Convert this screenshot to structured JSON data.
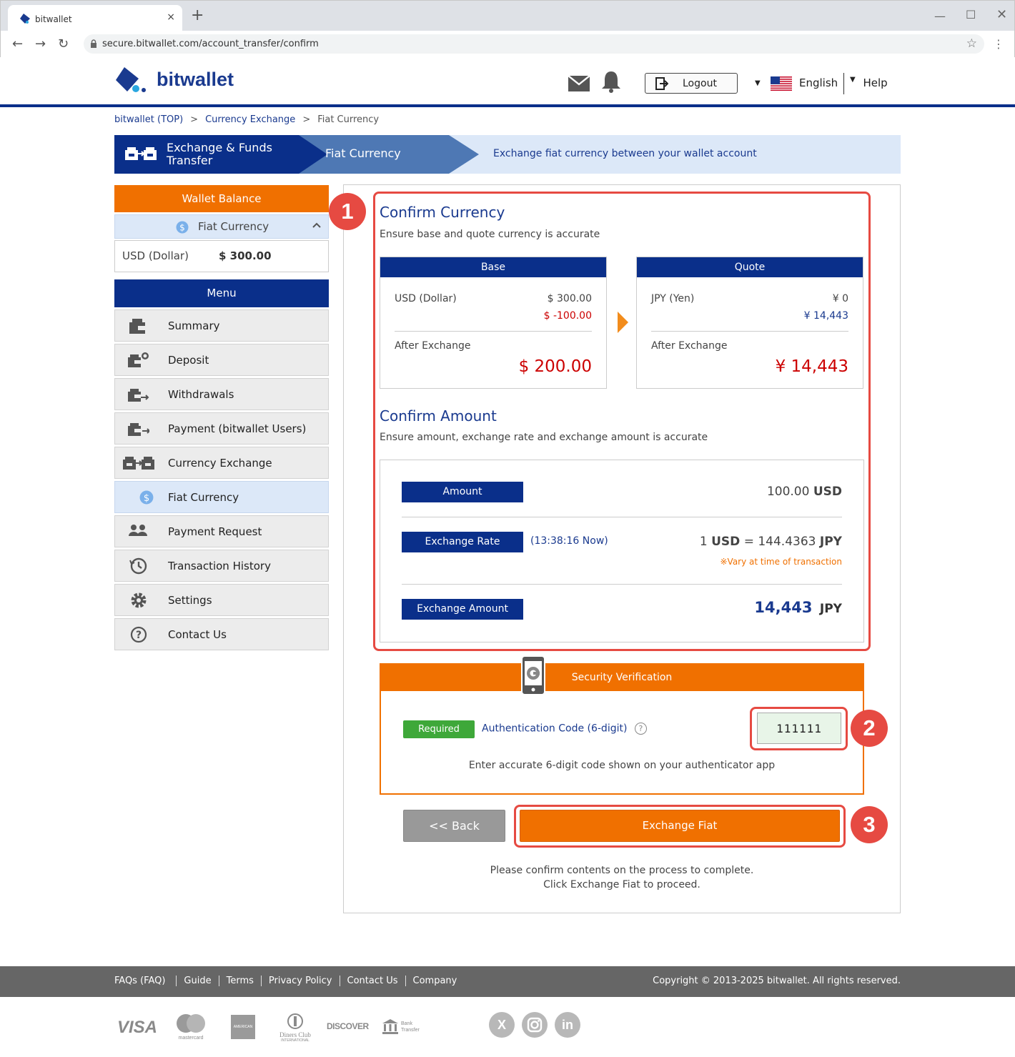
{
  "browser": {
    "tab_title": "bitwallet",
    "tab_close": "×",
    "new_tab": "+",
    "url": "secure.bitwallet.com/account_transfer/confirm"
  },
  "header": {
    "logo_text": "bitwallet",
    "logout_label": "Logout",
    "language_label": "English",
    "help_label": "Help"
  },
  "breadcrumb": {
    "items": [
      "bitwallet (TOP)",
      "Currency Exchange",
      "Fiat Currency"
    ],
    "separator": ">"
  },
  "banner": {
    "step1": "Exchange & Funds Transfer",
    "step2": "Fiat Currency",
    "description": "Exchange fiat currency between your wallet account"
  },
  "sidebar": {
    "wallet_title": "Wallet Balance",
    "fiat_toggle": "Fiat Currency",
    "balance_currency": "USD (Dollar)",
    "balance_amount": "$ 300.00",
    "menu_title": "Menu",
    "items": [
      {
        "label": "Summary",
        "icon": "wallet-icon"
      },
      {
        "label": "Deposit",
        "icon": "deposit-icon"
      },
      {
        "label": "Withdrawals",
        "icon": "withdrawal-icon"
      },
      {
        "label": "Payment (bitwallet Users)",
        "icon": "payment-icon"
      },
      {
        "label": "Currency Exchange",
        "icon": "exchange-icon"
      },
      {
        "label": "Fiat Currency",
        "icon": "dollar-icon"
      },
      {
        "label": "Payment Request",
        "icon": "users-icon"
      },
      {
        "label": "Transaction History",
        "icon": "history-icon"
      },
      {
        "label": "Settings",
        "icon": "gear-icon"
      },
      {
        "label": "Contact Us",
        "icon": "question-icon"
      }
    ]
  },
  "confirm_currency": {
    "title": "Confirm Currency",
    "description": "Ensure base and quote currency is accurate",
    "base": {
      "header": "Base",
      "currency": "USD (Dollar)",
      "current": "$ 300.00",
      "change": "$ -100.00",
      "after_label": "After Exchange",
      "after_value": "$ 200.00"
    },
    "quote": {
      "header": "Quote",
      "currency": "JPY (Yen)",
      "current": "¥ 0",
      "change": "¥ 14,443",
      "after_label": "After Exchange",
      "after_value": "¥ 14,443"
    }
  },
  "confirm_amount": {
    "title": "Confirm Amount",
    "description": "Ensure amount, exchange rate and exchange amount is accurate",
    "amount_label": "Amount",
    "amount_value": "100.00",
    "amount_unit": "USD",
    "rate_label": "Exchange Rate",
    "rate_time": "(13:38:16 Now)",
    "rate_lhs": "1",
    "rate_lhs_unit": "USD",
    "rate_eq": "=",
    "rate_value": "144.4363",
    "rate_unit": "JPY",
    "rate_note": "※Vary at time of transaction",
    "exchange_label": "Exchange Amount",
    "exchange_value": "14,443",
    "exchange_unit": "JPY"
  },
  "security": {
    "title": "Security Verification",
    "required": "Required",
    "auth_label": "Authentication Code (6-digit)",
    "auth_help": "?",
    "auth_value": "111111",
    "note": "Enter accurate 6-digit code shown on your authenticator app"
  },
  "actions": {
    "back": "<< Back",
    "exchange": "Exchange Fiat",
    "note_line1": "Please confirm contents on the process to complete.",
    "note_line2": "Click Exchange Fiat to proceed."
  },
  "steps": [
    "1",
    "2",
    "3"
  ],
  "footer": {
    "links": [
      "FAQs (FAQ)",
      "Guide",
      "Terms",
      "Privacy Policy",
      "Contact Us",
      "Company"
    ],
    "copyright": "Copyright © 2013-2025 bitwallet. All rights reserved.",
    "payment_logos": {
      "visa": "VISA",
      "mastercard": "mastercard",
      "amex": "AMERICAN EXPRESS",
      "diners": "Diners Club",
      "diners_sub": "INTERNATIONAL",
      "discover": "DISCOVER",
      "bank": "Bank",
      "bank_sub": "Transfer"
    },
    "social": [
      "X",
      "in"
    ]
  },
  "colors": {
    "navy": "#0a2f8a",
    "orange": "#f07000",
    "red": "#e64a42",
    "green": "#3ea839"
  }
}
